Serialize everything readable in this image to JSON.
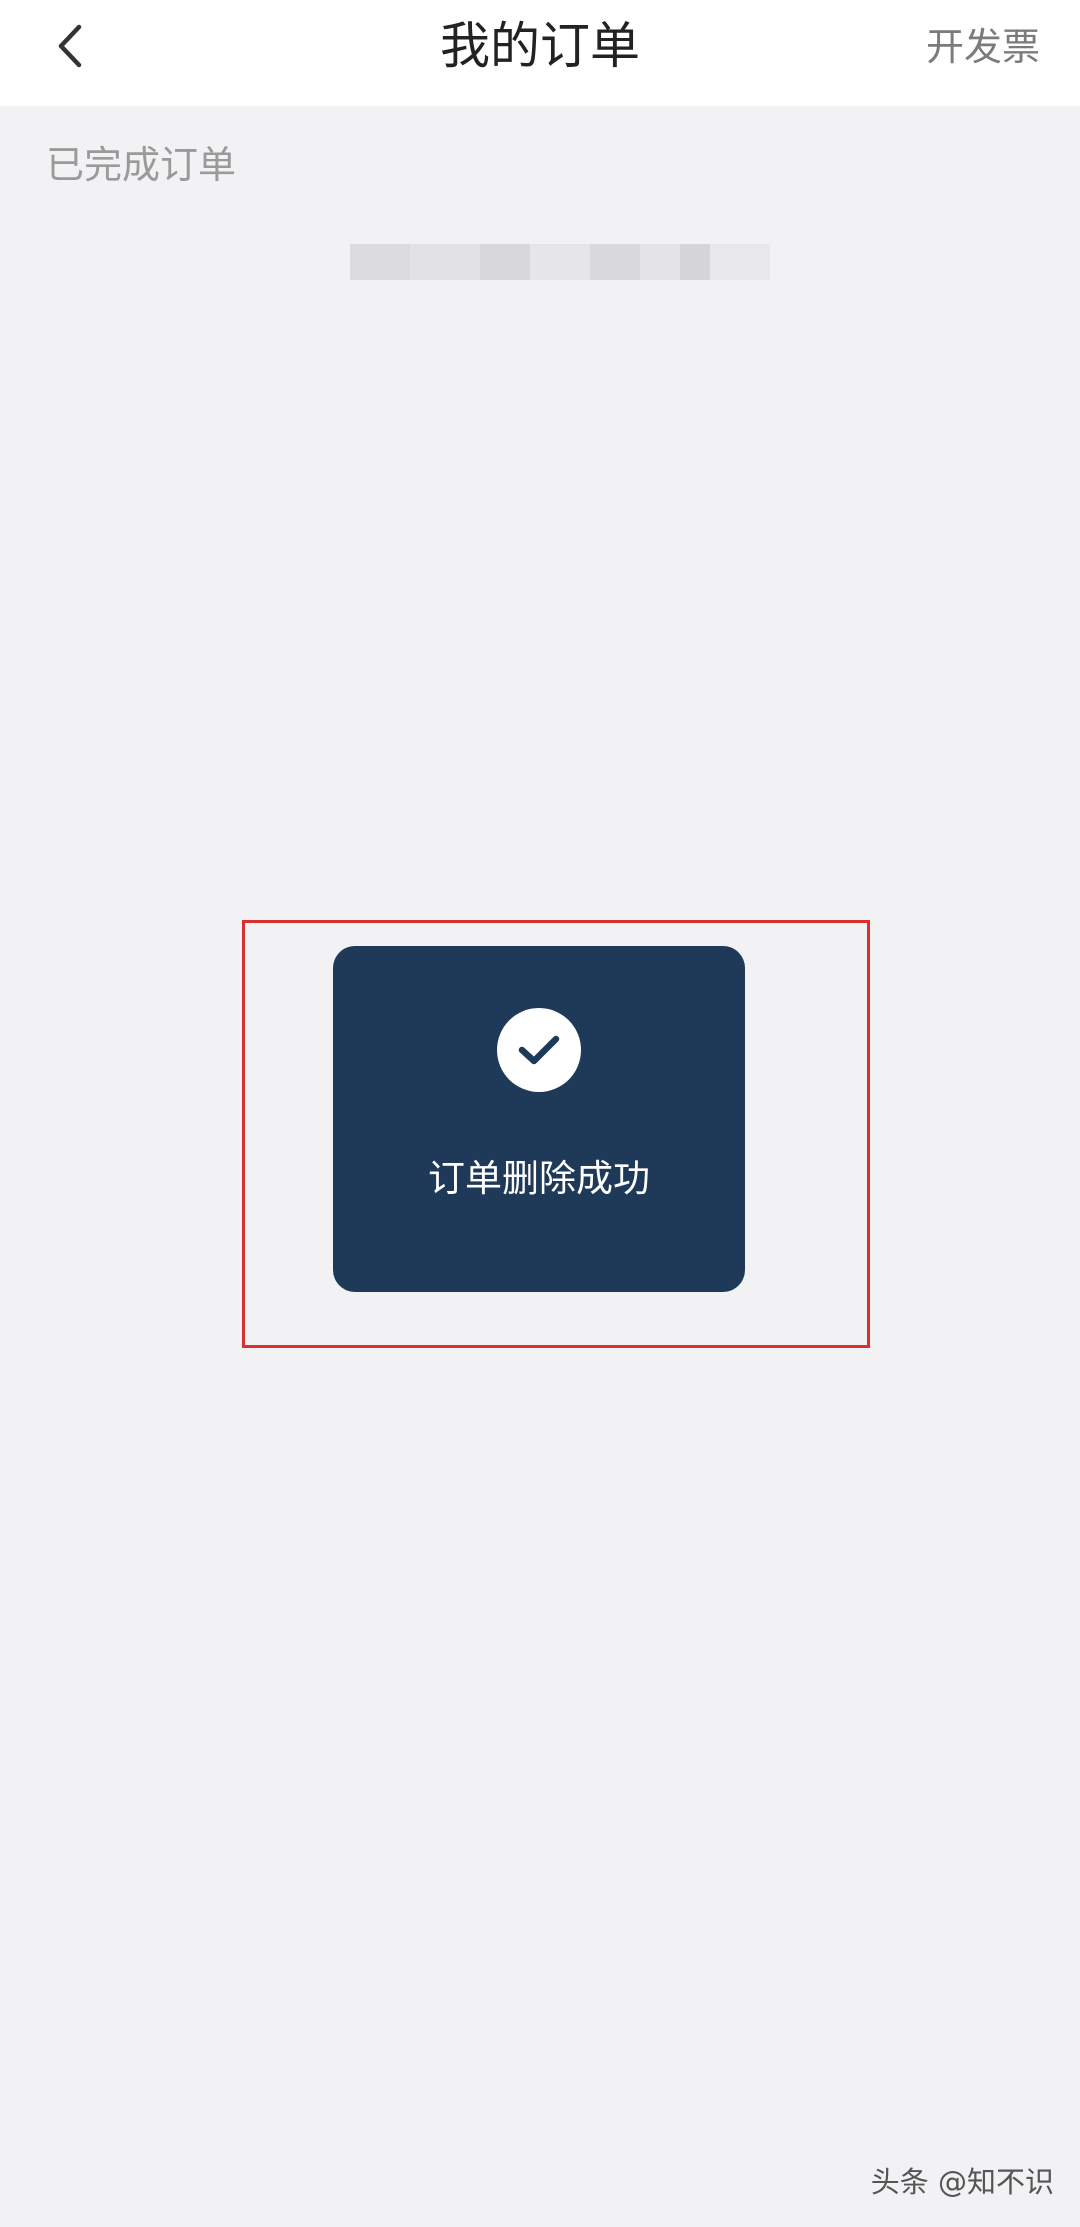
{
  "header": {
    "title": "我的订单",
    "right_action": "开发票",
    "back_icon": "chevron-left-icon"
  },
  "section": {
    "label": "已完成订单"
  },
  "toast": {
    "icon": "check-circle-icon",
    "message": "订单删除成功",
    "background": "#1f3a58"
  },
  "annotation": {
    "color": "#d8302c"
  },
  "watermark": {
    "text": "头条 @知不识"
  }
}
